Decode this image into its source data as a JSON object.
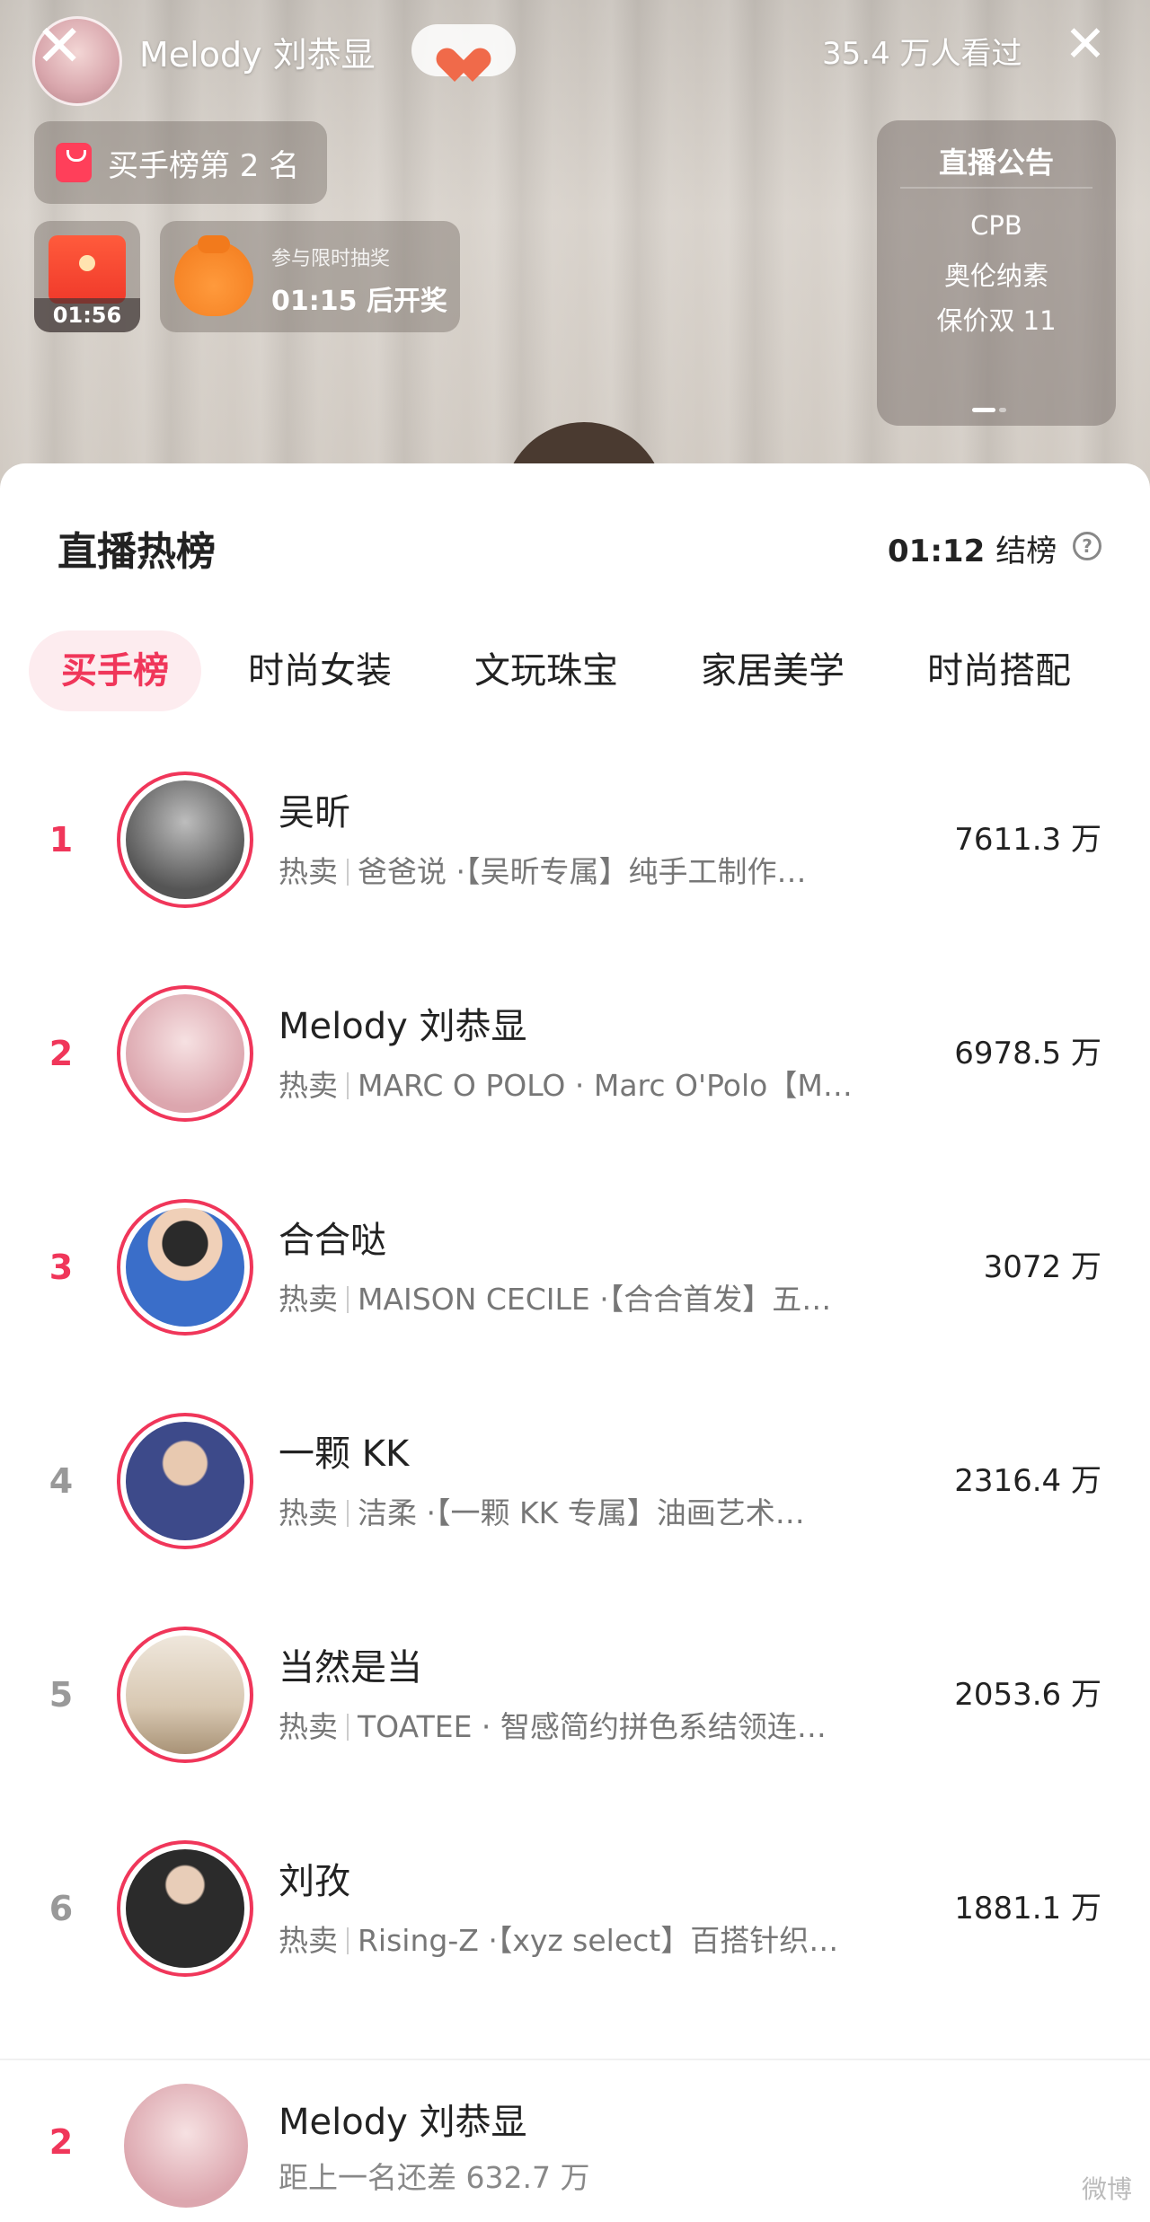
{
  "stream": {
    "host_name": "Melody 刘恭显",
    "viewer_count": "35.4 万人看过",
    "rank_chip": "买手榜第 2 名",
    "redpacket_timer": "01:56",
    "lottery_small": "参与限时抽奖",
    "lottery_main": "01:15 后开奖",
    "notice": {
      "title": "直播公告",
      "lines": [
        "CPB",
        "奥伦纳素",
        "保价双 11"
      ]
    }
  },
  "sheet": {
    "title": "直播热榜",
    "countdown_time": "01:12",
    "countdown_label": "结榜",
    "help": "?",
    "tabs": [
      "买手榜",
      "时尚女装",
      "文玩珠宝",
      "家居美学",
      "时尚搭配"
    ],
    "active_tab": 0
  },
  "rows": [
    {
      "rank": "1",
      "name": "吴昕",
      "hot": "热卖",
      "desc": "爸爸说 ·【吴昕专属】纯手工制作…",
      "value": "7611.3 万",
      "avatar_color": "#6c6c6c"
    },
    {
      "rank": "2",
      "name": "Melody 刘恭显",
      "hot": "热卖",
      "desc": "MARC O POLO · Marc O'Polo【M…",
      "value": "6978.5 万",
      "avatar_color": "#e6b9bf"
    },
    {
      "rank": "3",
      "name": "合合哒",
      "hot": "热卖",
      "desc": "MAISON CECILE ·【合合首发】五…",
      "value": "3072 万",
      "avatar_color": "#3a6ec9"
    },
    {
      "rank": "4",
      "name": "一颗 KK",
      "hot": "热卖",
      "desc": "洁柔 ·【一颗 KK 专属】油画艺术…",
      "value": "2316.4 万",
      "avatar_color": "#3d4a8a"
    },
    {
      "rank": "5",
      "name": "当然是当",
      "hot": "热卖",
      "desc": "TOATEE · 智感简约拼色系结领连…",
      "value": "2053.6 万",
      "avatar_color": "#cbbba6"
    },
    {
      "rank": "6",
      "name": "刘孜",
      "hot": "热卖",
      "desc": "Rising-Z ·【xyz select】百搭针织…",
      "value": "1881.1 万",
      "avatar_color": "#2b2b2b"
    }
  ],
  "self_row": {
    "rank": "2",
    "name": "Melody 刘恭显",
    "gap_text": "距上一名还差 632.7 万",
    "watermark": "微博"
  },
  "colors": {
    "accent": "#f0365a",
    "accent_bg": "#fdecef"
  }
}
